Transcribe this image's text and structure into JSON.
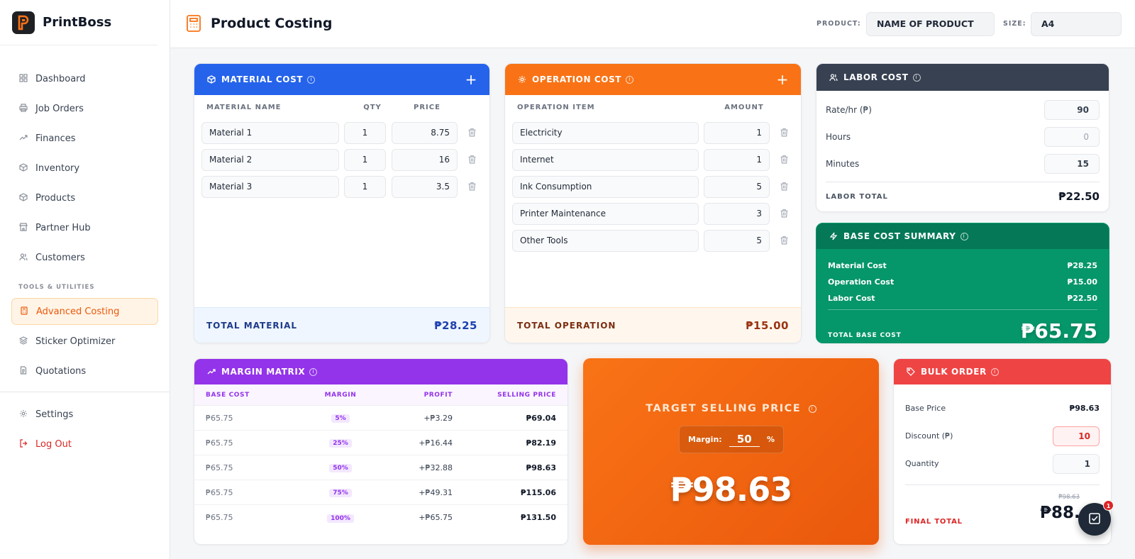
{
  "brand": {
    "name": "PrintBoss",
    "logo_letter": "P"
  },
  "nav": {
    "items": [
      {
        "label": "Dashboard",
        "icon": "grid-icon"
      },
      {
        "label": "Job Orders",
        "icon": "printer-icon"
      },
      {
        "label": "Finances",
        "icon": "trend-icon"
      },
      {
        "label": "Inventory",
        "icon": "box-icon"
      },
      {
        "label": "Products",
        "icon": "box-icon"
      },
      {
        "label": "Partner Hub",
        "icon": "store-icon"
      },
      {
        "label": "Customers",
        "icon": "users-icon"
      }
    ],
    "section_label": "TOOLS & UTILITIES",
    "tools": [
      {
        "label": "Advanced Costing",
        "icon": "calculator-icon",
        "active": true
      },
      {
        "label": "Sticker Optimizer",
        "icon": "layers-icon"
      },
      {
        "label": "Quotations",
        "icon": "document-icon"
      }
    ],
    "settings_label": "Settings",
    "logout_label": "Log Out"
  },
  "header": {
    "title": "Product Costing",
    "product_label": "PRODUCT:",
    "product_value": "NAME OF PRODUCT",
    "size_label": "SIZE:",
    "size_value": "A4"
  },
  "material": {
    "title": "MATERIAL COST",
    "col_name": "MATERIAL NAME",
    "col_qty": "QTY",
    "col_price": "PRICE",
    "rows": [
      {
        "name": "Material 1",
        "qty": "1",
        "price": "8.75"
      },
      {
        "name": "Material 2",
        "qty": "1",
        "price": "16"
      },
      {
        "name": "Material 3",
        "qty": "1",
        "price": "3.5"
      }
    ],
    "total_label": "TOTAL MATERIAL",
    "total_value": "₱28.25"
  },
  "operation": {
    "title": "OPERATION COST",
    "col_item": "OPERATION ITEM",
    "col_amount": "AMOUNT",
    "rows": [
      {
        "name": "Electricity",
        "amount": "1"
      },
      {
        "name": "Internet",
        "amount": "1"
      },
      {
        "name": "Ink Consumption",
        "amount": "5"
      },
      {
        "name": "Printer Maintenance",
        "amount": "3"
      },
      {
        "name": "Other Tools",
        "amount": "5"
      }
    ],
    "total_label": "TOTAL OPERATION",
    "total_value": "₱15.00"
  },
  "labor": {
    "title": "LABOR COST",
    "rate_label": "Rate/hr (₱)",
    "rate_value": "90",
    "hours_label": "Hours",
    "hours_value": "0",
    "minutes_label": "Minutes",
    "minutes_value": "15",
    "total_label": "LABOR TOTAL",
    "total_value": "₱22.50"
  },
  "base_summary": {
    "title": "BASE COST SUMMARY",
    "rows": [
      {
        "label": "Material Cost",
        "value": "₱28.25"
      },
      {
        "label": "Operation Cost",
        "value": "₱15.00"
      },
      {
        "label": "Labor Cost",
        "value": "₱22.50"
      }
    ],
    "total_label": "TOTAL BASE COST",
    "total_value": "₱65.75"
  },
  "margin_matrix": {
    "title": "MARGIN MATRIX",
    "cols": [
      "BASE COST",
      "MARGIN",
      "PROFIT",
      "SELLING PRICE"
    ],
    "rows": [
      {
        "base": "₱65.75",
        "margin": "5%",
        "profit": "+₱3.29",
        "price": "₱69.04"
      },
      {
        "base": "₱65.75",
        "margin": "25%",
        "profit": "+₱16.44",
        "price": "₱82.19"
      },
      {
        "base": "₱65.75",
        "margin": "50%",
        "profit": "+₱32.88",
        "price": "₱98.63"
      },
      {
        "base": "₱65.75",
        "margin": "75%",
        "profit": "+₱49.31",
        "price": "₱115.06"
      },
      {
        "base": "₱65.75",
        "margin": "100%",
        "profit": "+₱65.75",
        "price": "₱131.50"
      }
    ]
  },
  "target": {
    "title": "TARGET SELLING PRICE",
    "margin_label": "Margin:",
    "margin_value": "50",
    "percent": "%",
    "price": "₱98.63"
  },
  "bulk": {
    "title": "BULK ORDER",
    "base_label": "Base Price",
    "base_value": "₱98.63",
    "discount_label": "Discount (₱)",
    "discount_value": "10",
    "qty_label": "Quantity",
    "qty_value": "1",
    "strike_value": "₱98.63",
    "final_label": "FINAL TOTAL",
    "final_value": "₱88."
  },
  "fab": {
    "badge": "1"
  },
  "colors": {
    "material": "#2563eb",
    "operation": "#f97316",
    "labor": "#374151",
    "base": "#059669",
    "margin": "#9333ea",
    "bulk": "#ef4444",
    "accent": "#ea580c"
  }
}
